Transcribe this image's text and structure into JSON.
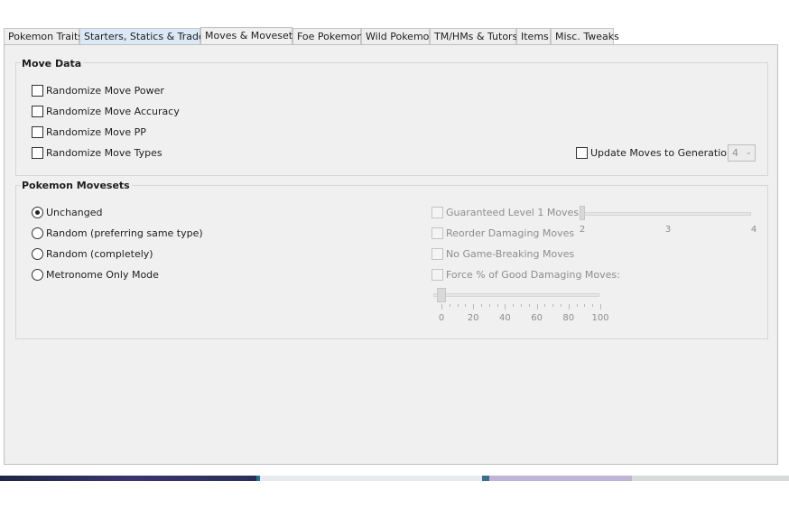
{
  "tabs": [
    {
      "label": "Pokemon Traits",
      "state": "normal"
    },
    {
      "label": "Starters, Statics & Trades",
      "state": "hover"
    },
    {
      "label": "Moves & Movesets",
      "state": "selected"
    },
    {
      "label": "Foe Pokemon",
      "state": "normal"
    },
    {
      "label": "Wild Pokemon",
      "state": "normal"
    },
    {
      "label": "TM/HMs & Tutors",
      "state": "normal"
    },
    {
      "label": "Items",
      "state": "normal"
    },
    {
      "label": "Misc. Tweaks",
      "state": "normal"
    }
  ],
  "move_data": {
    "title": "Move Data",
    "options": [
      {
        "label": "Randomize Move Power",
        "checked": false
      },
      {
        "label": "Randomize Move Accuracy",
        "checked": false
      },
      {
        "label": "Randomize Move PP",
        "checked": false
      },
      {
        "label": "Randomize Move Types",
        "checked": false
      }
    ],
    "update_generation": {
      "label": "Update Moves to Generation:",
      "checked": false,
      "value": "4"
    }
  },
  "movesets": {
    "title": "Pokemon Movesets",
    "radios": [
      {
        "label": "Unchanged",
        "selected": true
      },
      {
        "label": "Random (preferring same type)",
        "selected": false
      },
      {
        "label": "Random (completely)",
        "selected": false
      },
      {
        "label": "Metronome Only Mode",
        "selected": false
      }
    ],
    "options": [
      {
        "label": "Guaranteed Level 1 Moves",
        "checked": false,
        "enabled": false
      },
      {
        "label": "Reorder Damaging Moves",
        "checked": false,
        "enabled": false
      },
      {
        "label": "No Game-Breaking Moves",
        "checked": false,
        "enabled": false
      },
      {
        "label": "Force % of Good Damaging Moves:",
        "checked": false,
        "enabled": false
      }
    ],
    "level1_slider": {
      "min": 2,
      "max": 4,
      "value": 2,
      "labels": [
        "2",
        "3",
        "4"
      ]
    },
    "good_damaging_slider": {
      "min": 0,
      "max": 100,
      "value": 0,
      "labels": [
        "0",
        "20",
        "40",
        "60",
        "80",
        "100"
      ]
    }
  },
  "colors": {
    "panel_bg": "#f0f0f0",
    "tab_hover": "#dbe8f5",
    "disabled_text": "#8d8d8d"
  }
}
